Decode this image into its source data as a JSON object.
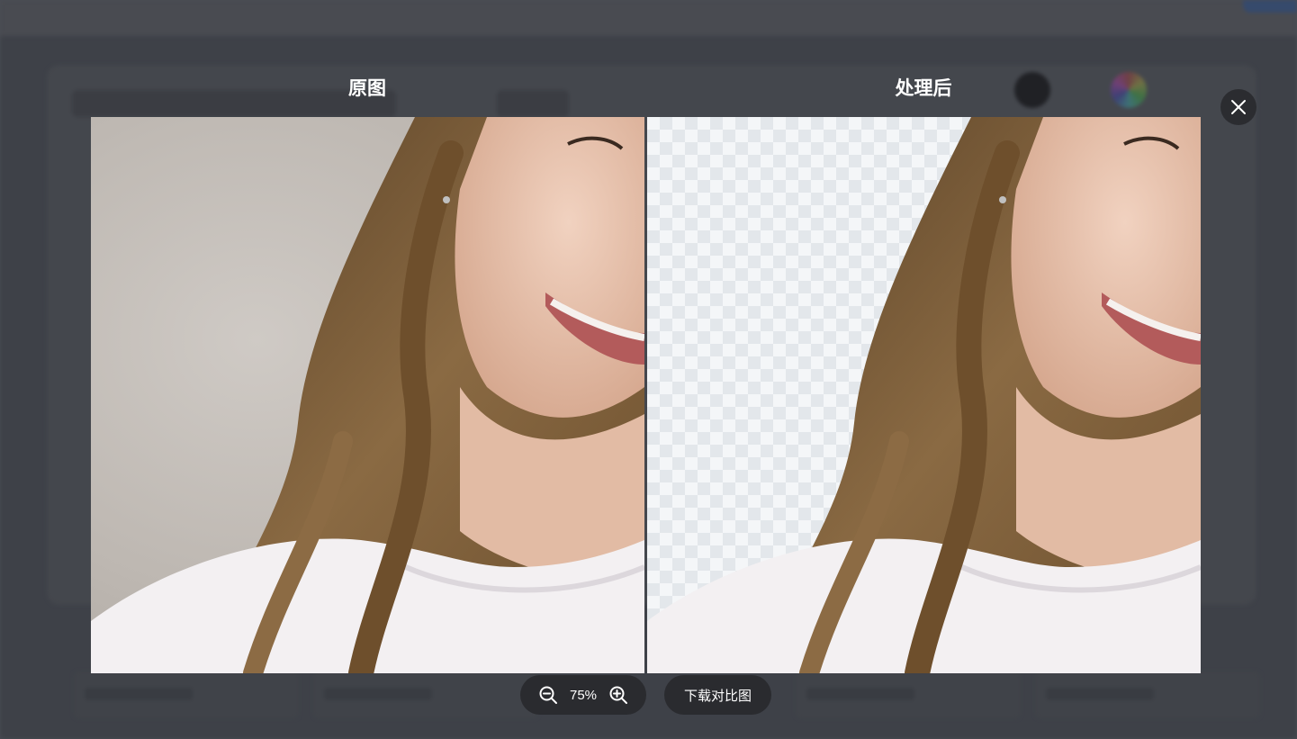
{
  "compare": {
    "original_label": "原图",
    "processed_label": "处理后",
    "zoom_value": "75%",
    "download_label": "下载对比图"
  },
  "icons": {
    "close": "close-icon",
    "zoom_out": "zoom-out-icon",
    "zoom_in": "zoom-in-icon"
  },
  "colors": {
    "button_bg": "#2a2b2f",
    "checker_light": "#f4f6f8",
    "checker_dark": "#e3e7eb",
    "backdrop": "#4a4d55"
  }
}
